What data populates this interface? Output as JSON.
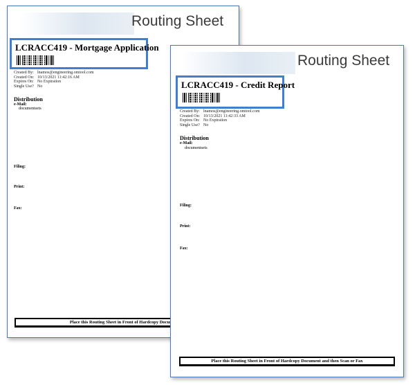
{
  "sheets": [
    {
      "title": "Routing Sheet",
      "job_title": "LCRACC419 - Mortgage Application",
      "meta": {
        "created_by_label": "Created By:",
        "created_by": "lnamos@engineering.omtool.com",
        "created_on_label": "Created On:",
        "created_on": "10/13/2021 11:42:16 AM",
        "expires_on_label": "Expires On:",
        "expires_on": "No Expiration",
        "single_use_label": "Single Use?",
        "single_use": "No"
      },
      "distribution_title": "Distribution",
      "email_label": "e-Mail:",
      "email_value": "documentsets",
      "filing_label": "Filing:",
      "print_label": "Print:",
      "fax_label": "Fax:",
      "footer": "Place this Routing Sheet in Front of Hardcopy Document and t"
    },
    {
      "title": "Routing Sheet",
      "job_title": "LCRACC419 - Credit Report",
      "meta": {
        "created_by_label": "Created By:",
        "created_by": "lnamos@engineering.omtool.com",
        "created_on_label": "Created On:",
        "created_on": "10/13/2021 11:42:33 AM",
        "expires_on_label": "Expires On:",
        "expires_on": "No Expiration",
        "single_use_label": "Single Use?",
        "single_use": "No"
      },
      "distribution_title": "Distribution",
      "email_label": "e-Mail:",
      "email_value": "documentsets",
      "filing_label": "Filing:",
      "print_label": "Print:",
      "fax_label": "Fax:",
      "footer": "Place this Routing Sheet in Front of Hardcopy Document and then Scan or Fax"
    }
  ],
  "colors": {
    "highlight_box": "#3f7fd3",
    "sheet_border": "#4a78b8"
  }
}
